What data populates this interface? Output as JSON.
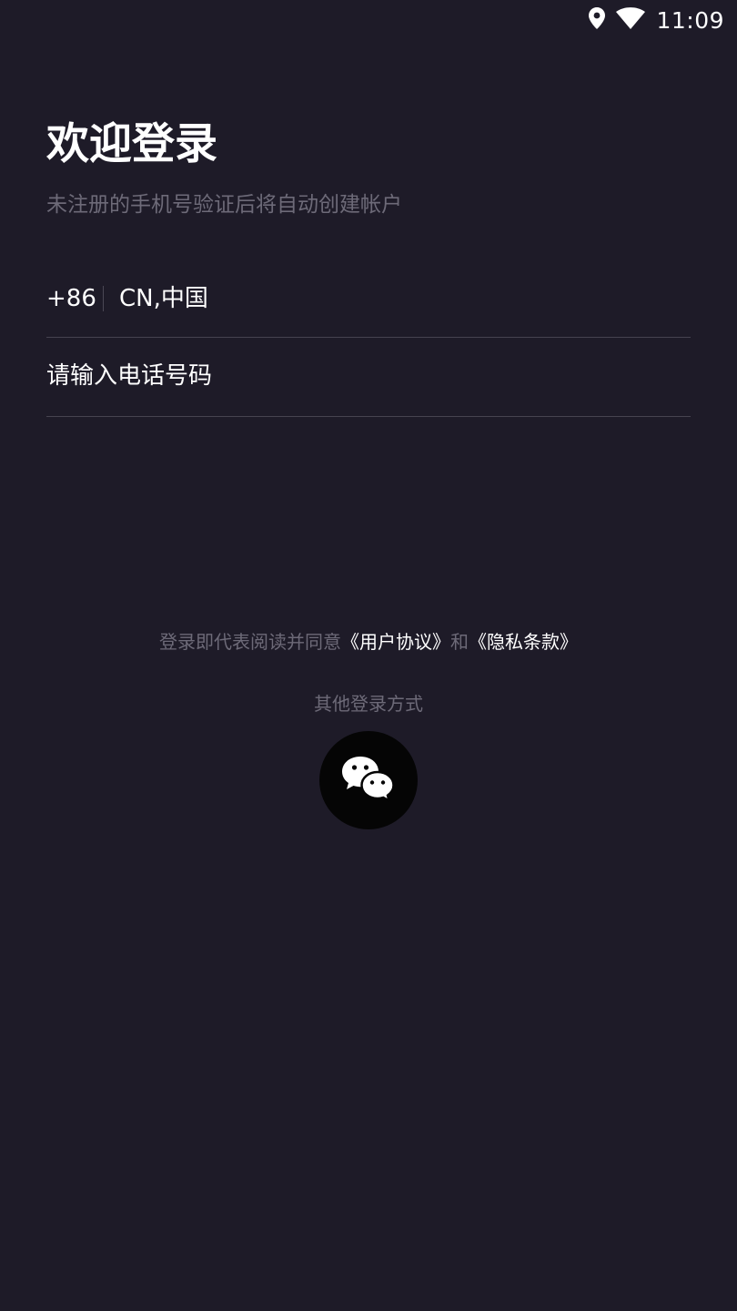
{
  "status_bar": {
    "time": "11:09",
    "icons": [
      "location-icon",
      "wifi-icon"
    ]
  },
  "login": {
    "title": "欢迎登录",
    "subtitle": "未注册的手机号验证后将自动创建帐户",
    "country_code": "+86",
    "country_name": "CN,中国",
    "phone_placeholder": "请输入电话号码"
  },
  "agreement": {
    "prefix": "登录即代表阅读并同意",
    "user_agreement": "《用户协议》",
    "conjunction": "和",
    "privacy_policy": "《隐私条款》"
  },
  "other_login": {
    "label": "其他登录方式",
    "methods": [
      "wechat-icon"
    ]
  },
  "colors": {
    "background": "#1e1b28",
    "text_primary": "#ffffff",
    "text_secondary": "#6d6a78",
    "divider": "#46434f",
    "wechat_button": "#050505"
  }
}
